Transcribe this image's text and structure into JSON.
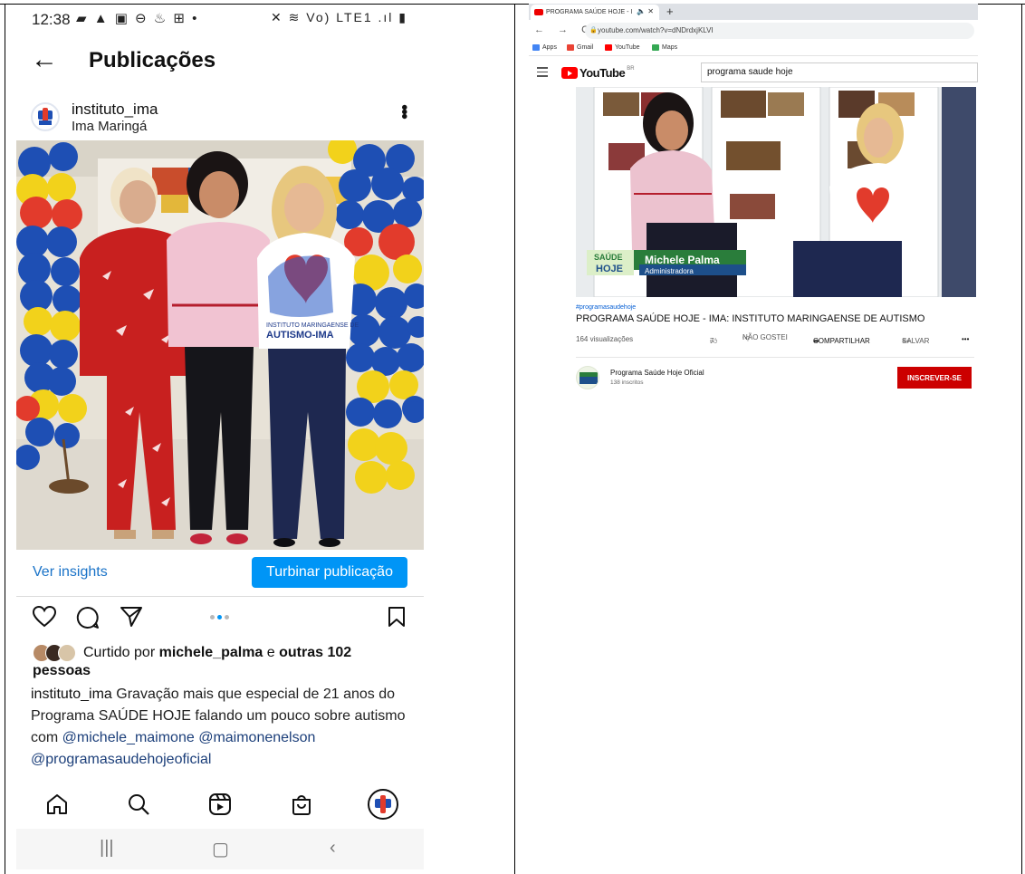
{
  "instagram": {
    "status": {
      "time": "12:38",
      "notifications": "▰ ▲ ▣ ⊖ ♨ ⊞ •",
      "system": "✕ ≋ Vo) LTE1 .ıl ▮"
    },
    "appbar": {
      "title": "Publicações"
    },
    "post": {
      "username": "instituto_ima",
      "location": "Ima Maringá",
      "ver_insights": "Ver insights",
      "boost_label": "Turbinar publicação",
      "likes_prefix": "Curtido por ",
      "likes_user": "michele_palma",
      "likes_middle": " e ",
      "likes_rest": "outras 102 pessoas",
      "caption_user": "instituto_ima",
      "caption_text": " Gravação mais que especial de 21 anos do Programa SAÚDE HOJE  falando um pouco sobre autismo com ",
      "mention_1": "@michele_maimone",
      "mention_2": "@maimonenelson",
      "mention_3": "@programasaudehojeoficial",
      "shirt_text_1": "INSTITUTO MARINGAENSE DE",
      "shirt_text_2": "AUTISMO-IMA"
    },
    "colors": {
      "accent": "#0095f6",
      "link": "#1a73c8",
      "balloon_blue": "#1e4fb4",
      "balloon_yellow": "#f2d21b",
      "balloon_red": "#e23b2c"
    }
  },
  "youtube": {
    "tab_title": "PROGRAMA SAÚDE HOJE - I",
    "url": "youtube.com/watch?v=dNDrdxjKLVI",
    "bookmarks": [
      "Apps",
      "Gmail",
      "YouTube",
      "Maps"
    ],
    "logo_word": "YouTube",
    "logo_region": "BR",
    "search_query": "programa saude hoje",
    "hashtag": "#programasaudehoje",
    "video_title": "PROGRAMA SAÚDE HOJE - IMA: INSTITUTO MARINGAENSE DE AUTISMO",
    "views": "164 visualizações",
    "likes": "7",
    "dislike_label": "NÃO GOSTEI",
    "share_label": "COMPARTILHAR",
    "save_label": "SALVAR",
    "channel_name": "Programa Saúde Hoje Oficial",
    "channel_subs": "138 inscritos",
    "subscribe_label": "INSCREVER-SE",
    "lower_third_brand_1": "SAÚDE",
    "lower_third_brand_2": "HOJE",
    "lower_third_name": "Michele Palma",
    "lower_third_role": "Administradora",
    "colors": {
      "brand_red": "#ff0000",
      "subscribe": "#cc0000",
      "link": "#065fd4"
    }
  }
}
